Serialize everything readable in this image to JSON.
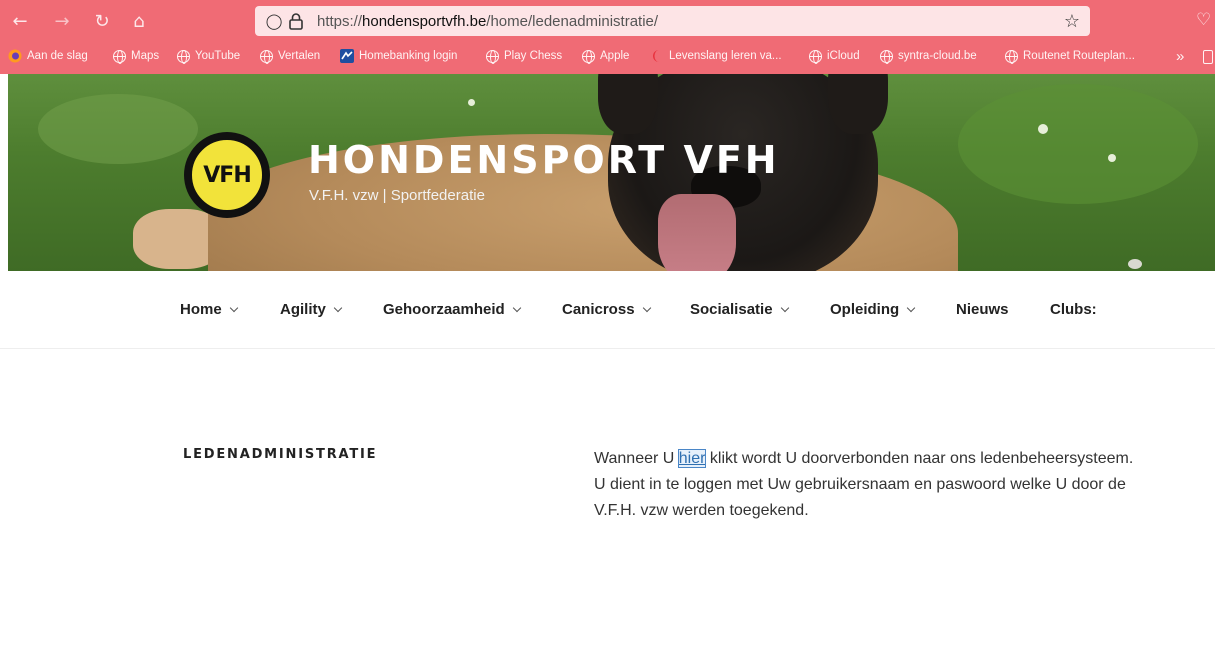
{
  "browser": {
    "url_prefix": "https://",
    "url_domain": "hondensportvfh.be",
    "url_path": "/home/ledenadministratie/",
    "icons": [
      "back-icon",
      "forward-icon",
      "reload-icon",
      "home-icon",
      "shield-icon",
      "lock-icon",
      "star-icon",
      "pocket-icon"
    ],
    "toolbar_color": "#f06b75"
  },
  "bookmarks": [
    {
      "label": "Aan de slag"
    },
    {
      "label": "Maps"
    },
    {
      "label": "YouTube"
    },
    {
      "label": "Vertalen"
    },
    {
      "label": "Homebanking login"
    },
    {
      "label": "Play Chess"
    },
    {
      "label": "Apple"
    },
    {
      "label": "Levenslang leren va..."
    },
    {
      "label": "iCloud"
    },
    {
      "label": "syntra-cloud.be"
    },
    {
      "label": "Routenet Routeplan..."
    }
  ],
  "header": {
    "logo_text": "VFH",
    "title": "HONDENSPORT VFH",
    "tagline": "V.F.H. vzw | Sportfederatie"
  },
  "nav": [
    {
      "label": "Home",
      "has_submenu": true
    },
    {
      "label": "Agility",
      "has_submenu": true
    },
    {
      "label": "Gehoorzaamheid",
      "has_submenu": true
    },
    {
      "label": "Canicross",
      "has_submenu": true
    },
    {
      "label": "Socialisatie",
      "has_submenu": true
    },
    {
      "label": "Opleiding",
      "has_submenu": true
    },
    {
      "label": "Nieuws",
      "has_submenu": false
    },
    {
      "label": "Clubs:",
      "has_submenu": false
    }
  ],
  "page": {
    "title": "LEDENADMINISTRATIE",
    "p1_before": "Wanneer U ",
    "p1_link": "hier",
    "p1_after": " klikt wordt U doorverbonden naar ons ledenbeheersysteem.",
    "p2": "U dient in te loggen met Uw gebruikersnaam en paswoord welke U door de V.F.H. vzw werden toegekend."
  }
}
